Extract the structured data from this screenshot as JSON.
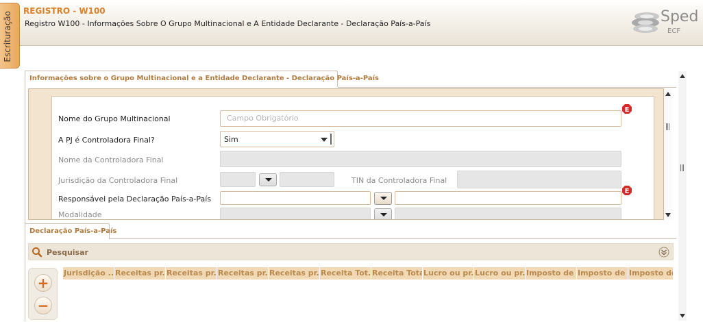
{
  "side_tab": {
    "label": "Escrituração"
  },
  "header": {
    "register": "REGISTRO - W100",
    "subtitle": "Registro W100 - Informações Sobre O Grupo Multinacional e A Entidade Declarante - Declaração País-a-País",
    "logo": {
      "text": "Sped",
      "subtext": "ECF"
    }
  },
  "top_tab": {
    "label": "Informações sobre o Grupo Multinacional e a Entidade Declarante - Declaração País-a-País"
  },
  "form": {
    "nome_grupo": {
      "label": "Nome do Grupo Multinacional",
      "placeholder": "Campo Obrigatório"
    },
    "pj_controladora": {
      "label": "A PJ é Controladora Final?",
      "value": "Sim"
    },
    "nome_controladora": {
      "label": "Nome da Controladora Final"
    },
    "jurisdicao": {
      "label": "Jurisdição da Controladora Final"
    },
    "tin": {
      "label": "TIN da Controladora Final"
    },
    "responsavel": {
      "label": "Responsável pela Declaração País-a-País"
    },
    "modalidade": {
      "label": "Modalidade"
    },
    "error_badge": "E"
  },
  "bottom_tab": {
    "label": "Declaração País-a-País"
  },
  "search": {
    "label": "Pesquisar"
  },
  "buttons": {
    "add": "+",
    "remove": "−"
  },
  "table": {
    "columns": [
      "Jurisdição ...",
      "Receitas pr...",
      "Receitas pr...",
      "Receitas pr...",
      "Receitas pr...",
      "Receita Tot...",
      "Receita Total",
      "Lucro ou pr...",
      "Lucro ou pr...",
      "Imposto de ...",
      "Imposto de ...",
      "Imposto de"
    ]
  },
  "colors": {
    "accent": "#d9822b",
    "tab_text": "#b07a3c",
    "column_header_bg": "#f2d9b6",
    "error": "#d42a2a"
  }
}
